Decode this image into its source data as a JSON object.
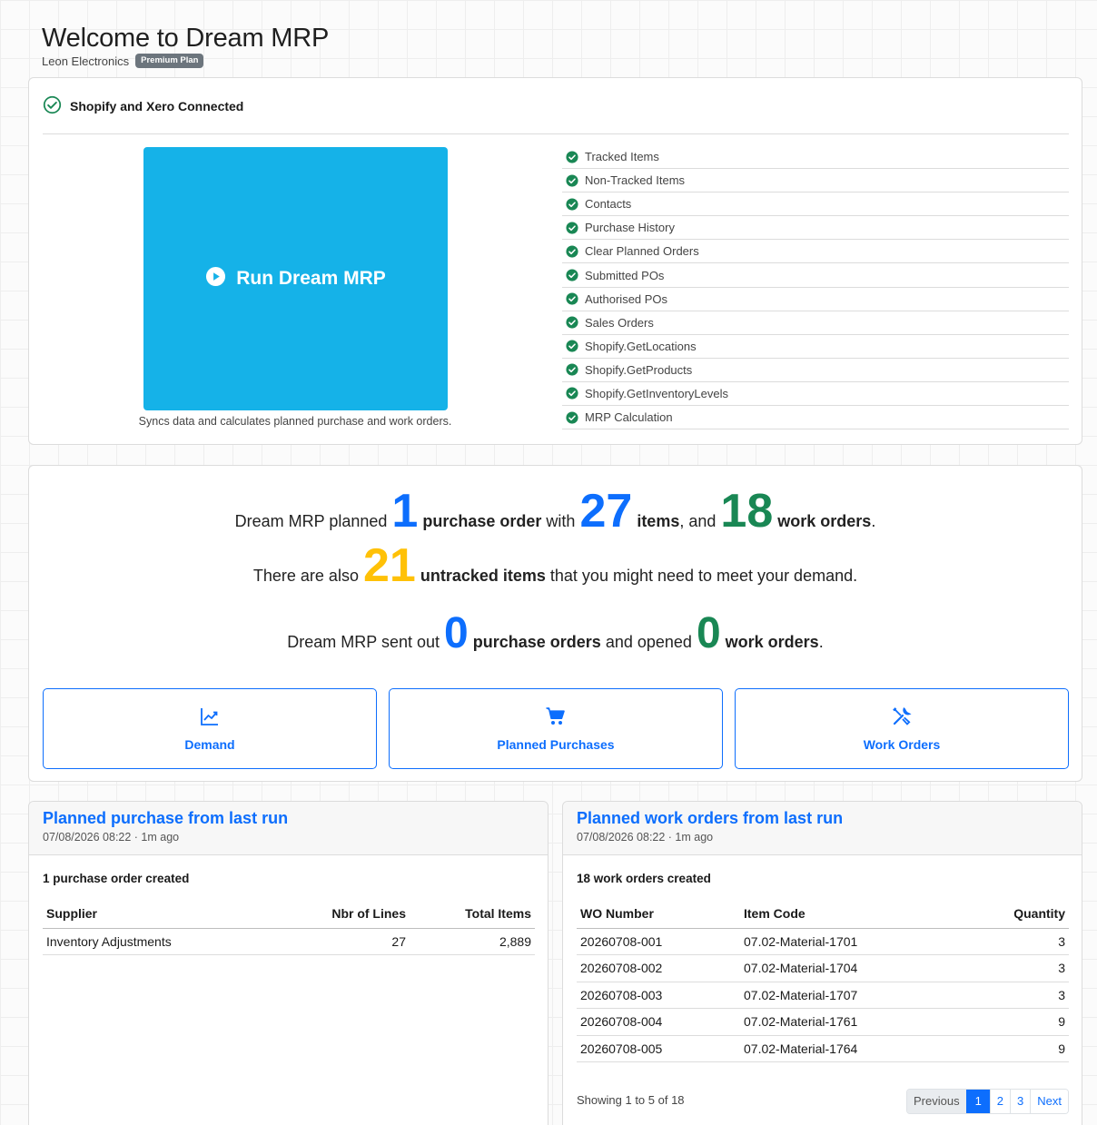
{
  "header": {
    "title": "Welcome to Dream MRP",
    "company": "Leon Electronics",
    "plan": "Premium Plan"
  },
  "sync": {
    "status": "Shopify and Xero Connected",
    "run_label": "Run Dream MRP",
    "run_caption": "Syncs data and calculates planned purchase and work orders.",
    "steps": [
      "Tracked Items",
      "Non-Tracked Items",
      "Contacts",
      "Purchase History",
      "Clear Planned Orders",
      "Submitted POs",
      "Authorised POs",
      "Sales Orders",
      "Shopify.GetLocations",
      "Shopify.GetProducts",
      "Shopify.GetInventoryLevels",
      "MRP Calculation"
    ]
  },
  "summary": {
    "line1": {
      "prefix": "Dream MRP planned",
      "po_count": "1",
      "po_label": "purchase order",
      "with": "with",
      "item_count": "27",
      "items_label": "items",
      "and": ", and",
      "wo_count": "18",
      "wo_label": "work orders",
      "end": "."
    },
    "line2": {
      "prefix": "There are also",
      "count": "21",
      "label": "untracked items",
      "suffix": "that you might need to meet your demand."
    },
    "line3": {
      "prefix": "Dream MRP sent out",
      "po_count": "0",
      "po_label": "purchase orders",
      "mid": "and opened",
      "wo_count": "0",
      "wo_label": "work orders",
      "end": "."
    },
    "buttons": {
      "demand": "Demand",
      "planned_purchases": "Planned Purchases",
      "work_orders": "Work Orders"
    }
  },
  "purchase_panel": {
    "title": "Planned purchase from last run",
    "timestamp": "07/08/2026 08:22 · 1m ago",
    "created": "1 purchase order created",
    "columns": [
      "Supplier",
      "Nbr of Lines",
      "Total Items"
    ],
    "rows": [
      [
        "Inventory Adjustments",
        "27",
        "2,889"
      ]
    ]
  },
  "work_panel": {
    "title": "Planned work orders from last run",
    "timestamp": "07/08/2026 08:22 · 1m ago",
    "created": "18 work orders created",
    "columns": [
      "WO Number",
      "Item Code",
      "Quantity"
    ],
    "rows": [
      [
        "20260708-001",
        "07.02-Material-1701",
        "3"
      ],
      [
        "20260708-002",
        "07.02-Material-1704",
        "3"
      ],
      [
        "20260708-003",
        "07.02-Material-1707",
        "3"
      ],
      [
        "20260708-004",
        "07.02-Material-1761",
        "9"
      ],
      [
        "20260708-005",
        "07.02-Material-1764",
        "9"
      ]
    ],
    "showing": "Showing 1 to 5 of 18",
    "pagination": {
      "previous": "Previous",
      "pages": [
        "1",
        "2",
        "3"
      ],
      "active_page": "1",
      "next": "Next"
    }
  },
  "colors": {
    "primary": "#0d6efd",
    "success": "#198754",
    "warning": "#ffc107",
    "run_button": "#15b2e8"
  }
}
